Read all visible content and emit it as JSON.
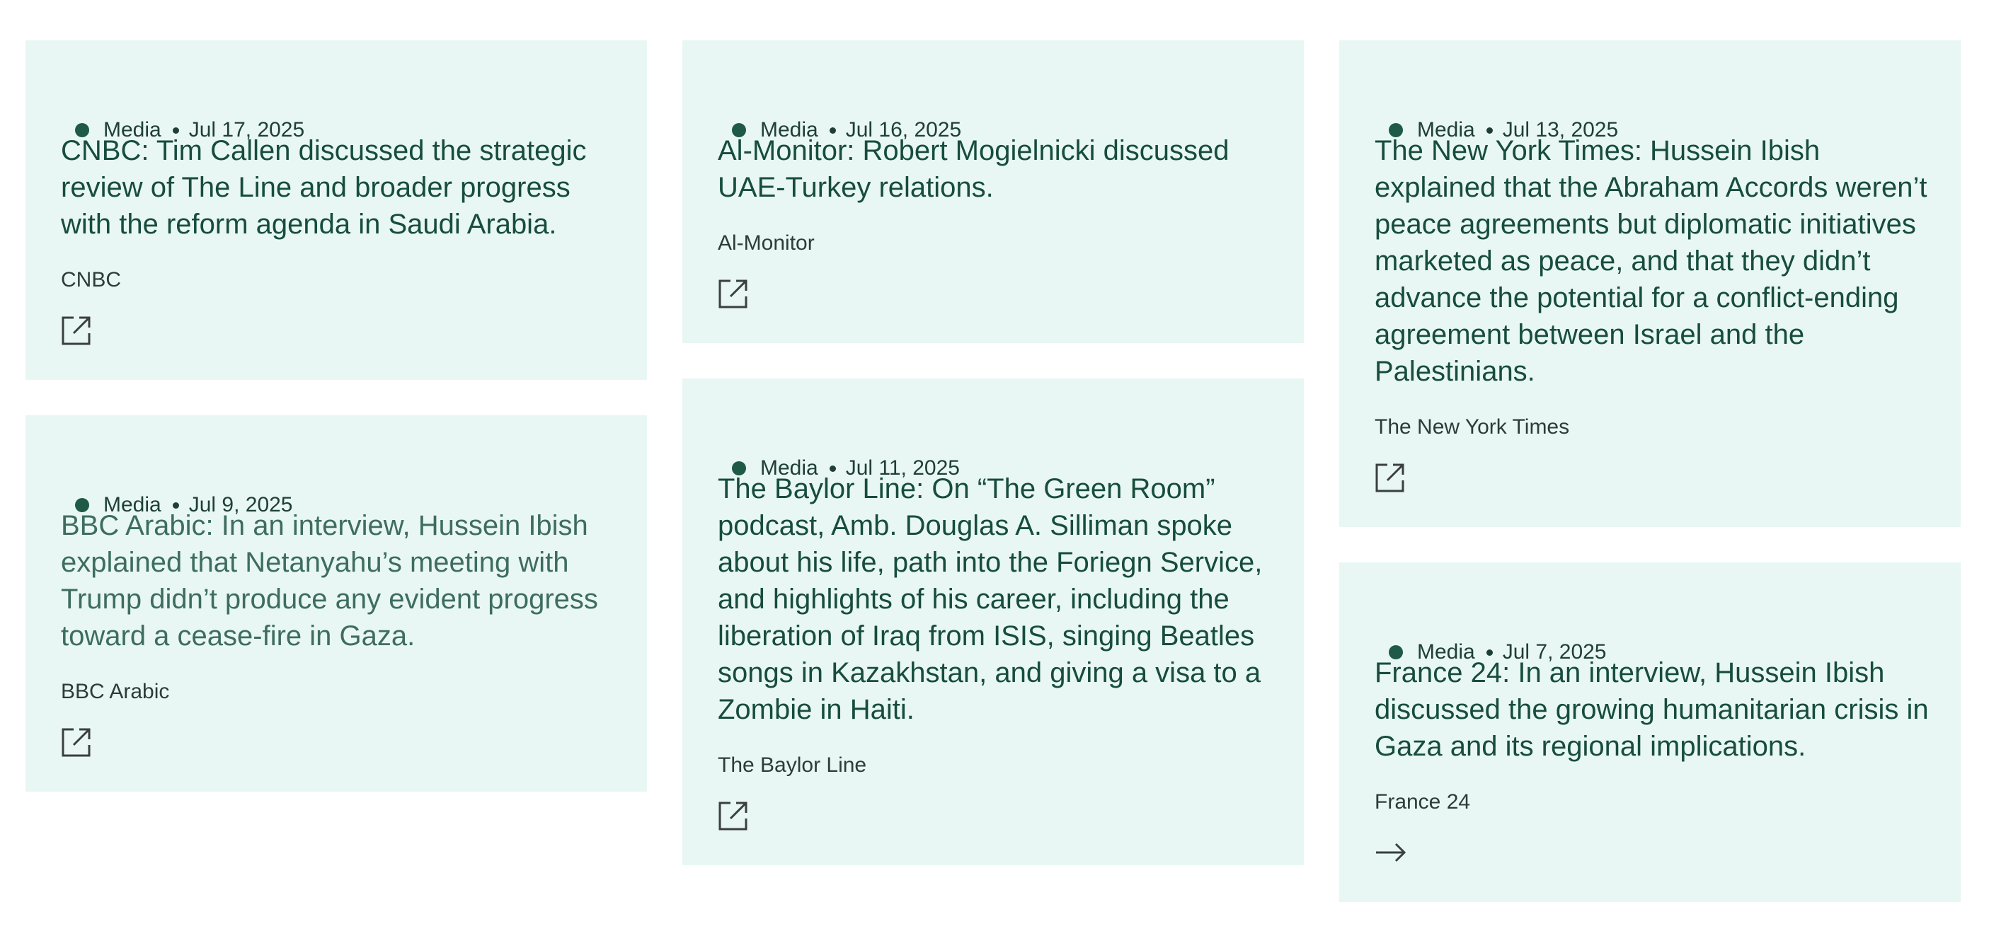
{
  "cards": [
    {
      "category": "Media",
      "date": "Jul 17, 2025",
      "title": "CNBC: Tim Callen discussed the strategic review of The Line and broader progress with the reform agenda in Saudi Arabia.",
      "source": "CNBC",
      "icon": "external-link-icon"
    },
    {
      "category": "Media",
      "date": "Jul 16, 2025",
      "title": "Al-Monitor: Robert Mogielnicki discussed UAE-Turkey relations.",
      "source": "Al-Monitor",
      "icon": "external-link-icon"
    },
    {
      "category": "Media",
      "date": "Jul 13, 2025",
      "title": "The New York Times: Hussein Ibish explained that the Abraham Accords weren’t peace agreements but diplomatic initiatives marketed as peace, and that they didn’t advance the potential for a conflict-ending agreement between Israel and the Palestinians.",
      "source": "The New York Times",
      "icon": "external-link-icon"
    },
    {
      "category": "Media",
      "date": "Jul 9, 2025",
      "title": "BBC Arabic: In an interview, Hussein Ibish explained that Netanyahu’s meeting with Trump didn’t produce any evident progress toward a cease-fire in Gaza.",
      "source": "BBC Arabic",
      "icon": "external-link-icon"
    },
    {
      "category": "Media",
      "date": "Jul 11, 2025",
      "title": "The Baylor Line: On “The Green Room” podcast,  Amb. Douglas A. Silliman spoke about his life, path into the Foriegn Service, and highlights of his career, including the liberation of Iraq from ISIS, singing Beatles songs in Kazakhstan, and giving a visa to a Zombie in Haiti.",
      "source": "The Baylor Line",
      "icon": "external-link-icon"
    },
    {
      "category": "Media",
      "date": "Jul 7, 2025",
      "title": "France 24: In an interview, Hussein Ibish discussed the growing humanitarian crisis in Gaza and its regional implications.",
      "source": "France 24",
      "icon": "arrow-right-icon"
    }
  ]
}
